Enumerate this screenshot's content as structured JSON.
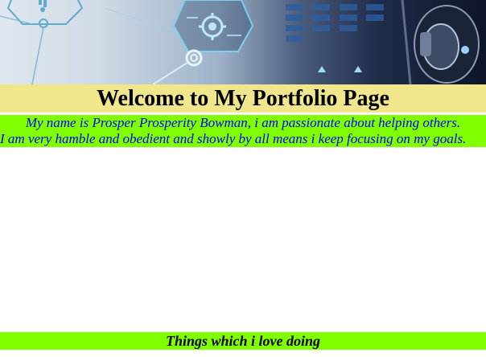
{
  "header": {
    "banner_image": "technology-circuit-hexagon-banner"
  },
  "title": "Welcome to My Portfolio Page",
  "intro": {
    "line1": "My name is Prosper Prosperity Bowman, i am passionate about helping others.",
    "line2": "I am very hamble and obedient and showly by all means i keep focusing on my goals."
  },
  "section": {
    "heading": "Things which i love doing"
  },
  "colors": {
    "title_background": "#f0e68c",
    "intro_background": "#80ff00",
    "intro_text": "#0000ff"
  }
}
